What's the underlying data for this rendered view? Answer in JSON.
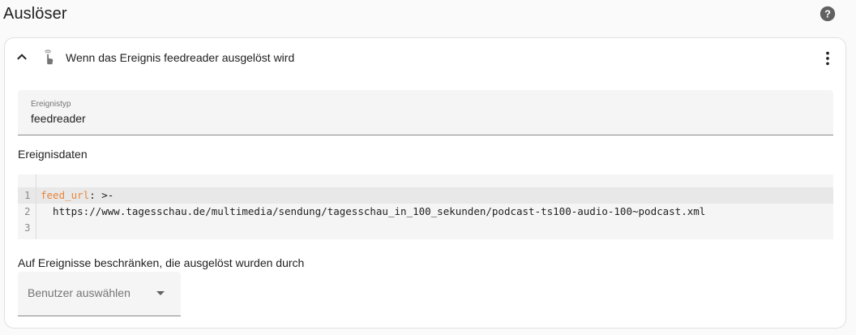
{
  "header": {
    "title": "Auslöser",
    "help_icon": "help-circle-icon"
  },
  "trigger": {
    "title": "Wenn das Ereignis feedreader ausgelöst wird",
    "icon": "gesture-tap-icon",
    "expanded": true
  },
  "event_type_field": {
    "label": "Ereignistyp",
    "value": "feedreader"
  },
  "event_data": {
    "label": "Ereignisdaten",
    "lines": [
      {
        "number": "1",
        "key": "feed_url",
        "rest": ": >-"
      },
      {
        "number": "2",
        "key": "",
        "rest": "  https://www.tagesschau.de/multimedia/sendung/tagesschau_in_100_sekunden/podcast-ts100-audio-100~podcast.xml"
      },
      {
        "number": "3",
        "key": "",
        "rest": ""
      }
    ]
  },
  "user_filter": {
    "label": "Auf Ereignisse beschränken, die ausgelöst wurden durch",
    "placeholder": "Benutzer auswählen"
  },
  "colors": {
    "yaml_key": "#e8863a",
    "icon_gray": "#616161"
  }
}
